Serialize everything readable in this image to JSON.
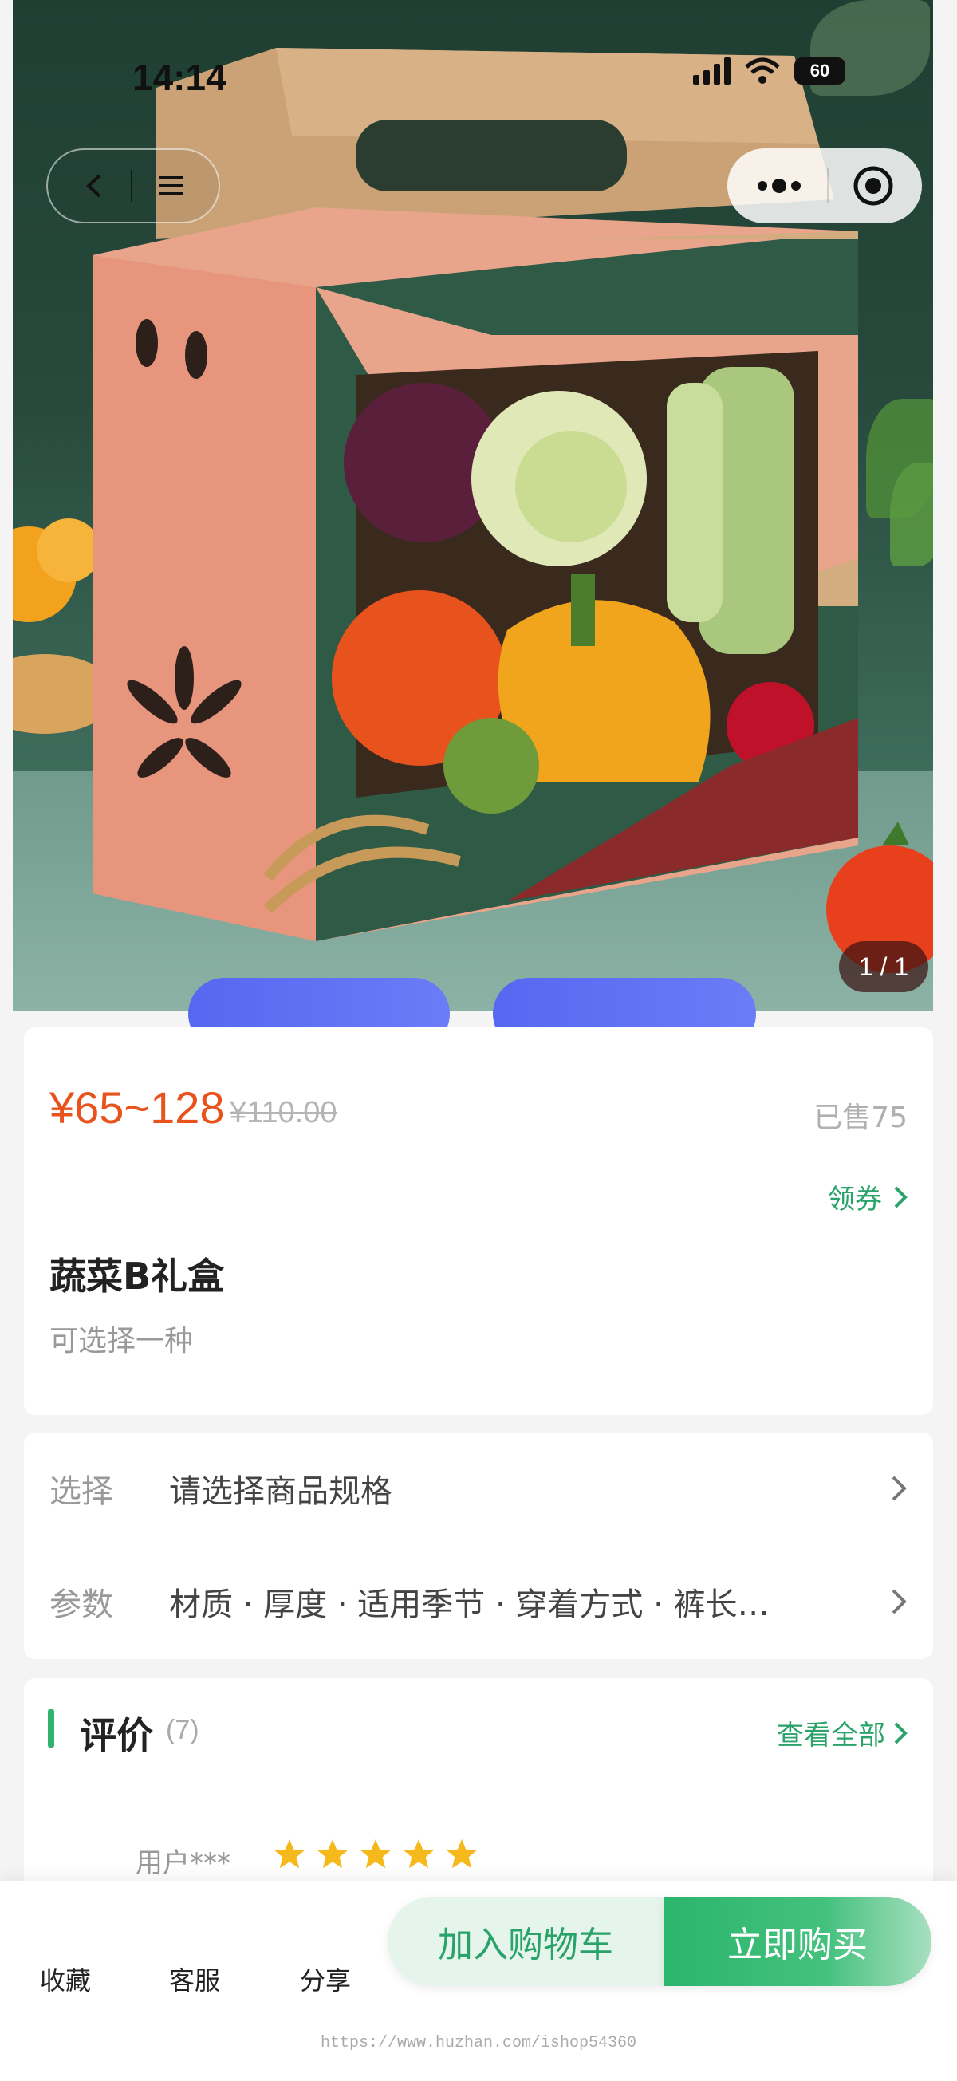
{
  "status_bar": {
    "time": "14:14",
    "battery": "60"
  },
  "hero": {
    "image_counter": "1 / 1"
  },
  "product": {
    "price": "¥65~128",
    "original_price": "¥110.00",
    "sold": "已售75",
    "coupon_label": "领券",
    "title": "蔬菜B礼盒",
    "subtitle": "可选择一种"
  },
  "specs": {
    "select_label": "选择",
    "select_value": "请选择商品规格",
    "params_label": "参数",
    "params_value": "材质 · 厚度 · 适用季节 · 穿着方式 · 裤长…"
  },
  "reviews": {
    "title": "评价",
    "count": "(7)",
    "view_all": "查看全部",
    "user": "用户***",
    "stars": 5
  },
  "bottom_bar": {
    "favorite": "收藏",
    "service": "客服",
    "share": "分享",
    "add_to_cart": "加入购物车",
    "buy_now": "立即购买"
  },
  "footer": {
    "watermark": "https://www.huzhan.com/ishop54360"
  },
  "colors": {
    "accent_green": "#2aa36a",
    "price_red": "#e8521c",
    "buy_gradient_start": "#2cb56c"
  }
}
